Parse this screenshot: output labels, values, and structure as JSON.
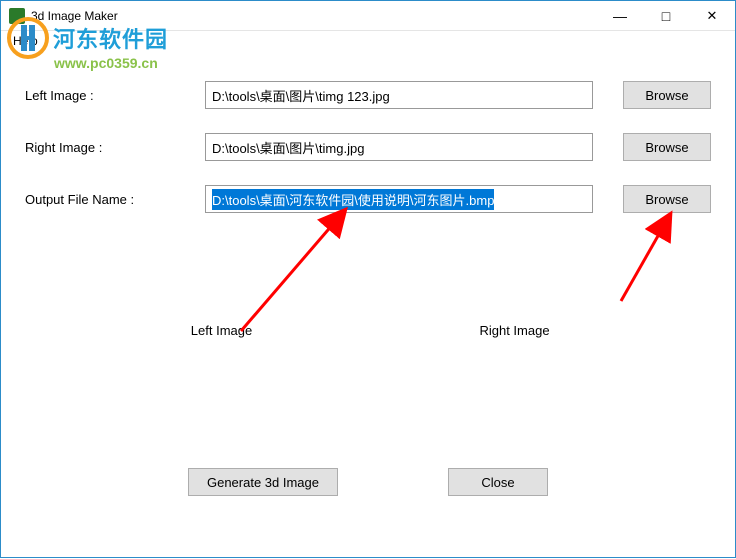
{
  "window": {
    "title": "3d Image Maker",
    "minimize": "—",
    "maximize": "□",
    "close": "✕"
  },
  "menu": {
    "help": "Help"
  },
  "watermark": {
    "main": "河东软件园",
    "sub": "www.pc0359.cn"
  },
  "form": {
    "left_label": "Left Image :",
    "right_label": "Right Image :",
    "output_label": "Output File Name :",
    "left_value": "D:\\tools\\桌面\\图片\\timg 123.jpg",
    "right_value": "D:\\tools\\桌面\\图片\\timg.jpg",
    "output_value": "D:\\tools\\桌面\\河东软件园\\使用说明\\河东图片.bmp",
    "browse": "Browse"
  },
  "preview": {
    "left": "Left Image",
    "right": "Right Image"
  },
  "actions": {
    "generate": "Generate 3d Image",
    "close": "Close"
  }
}
